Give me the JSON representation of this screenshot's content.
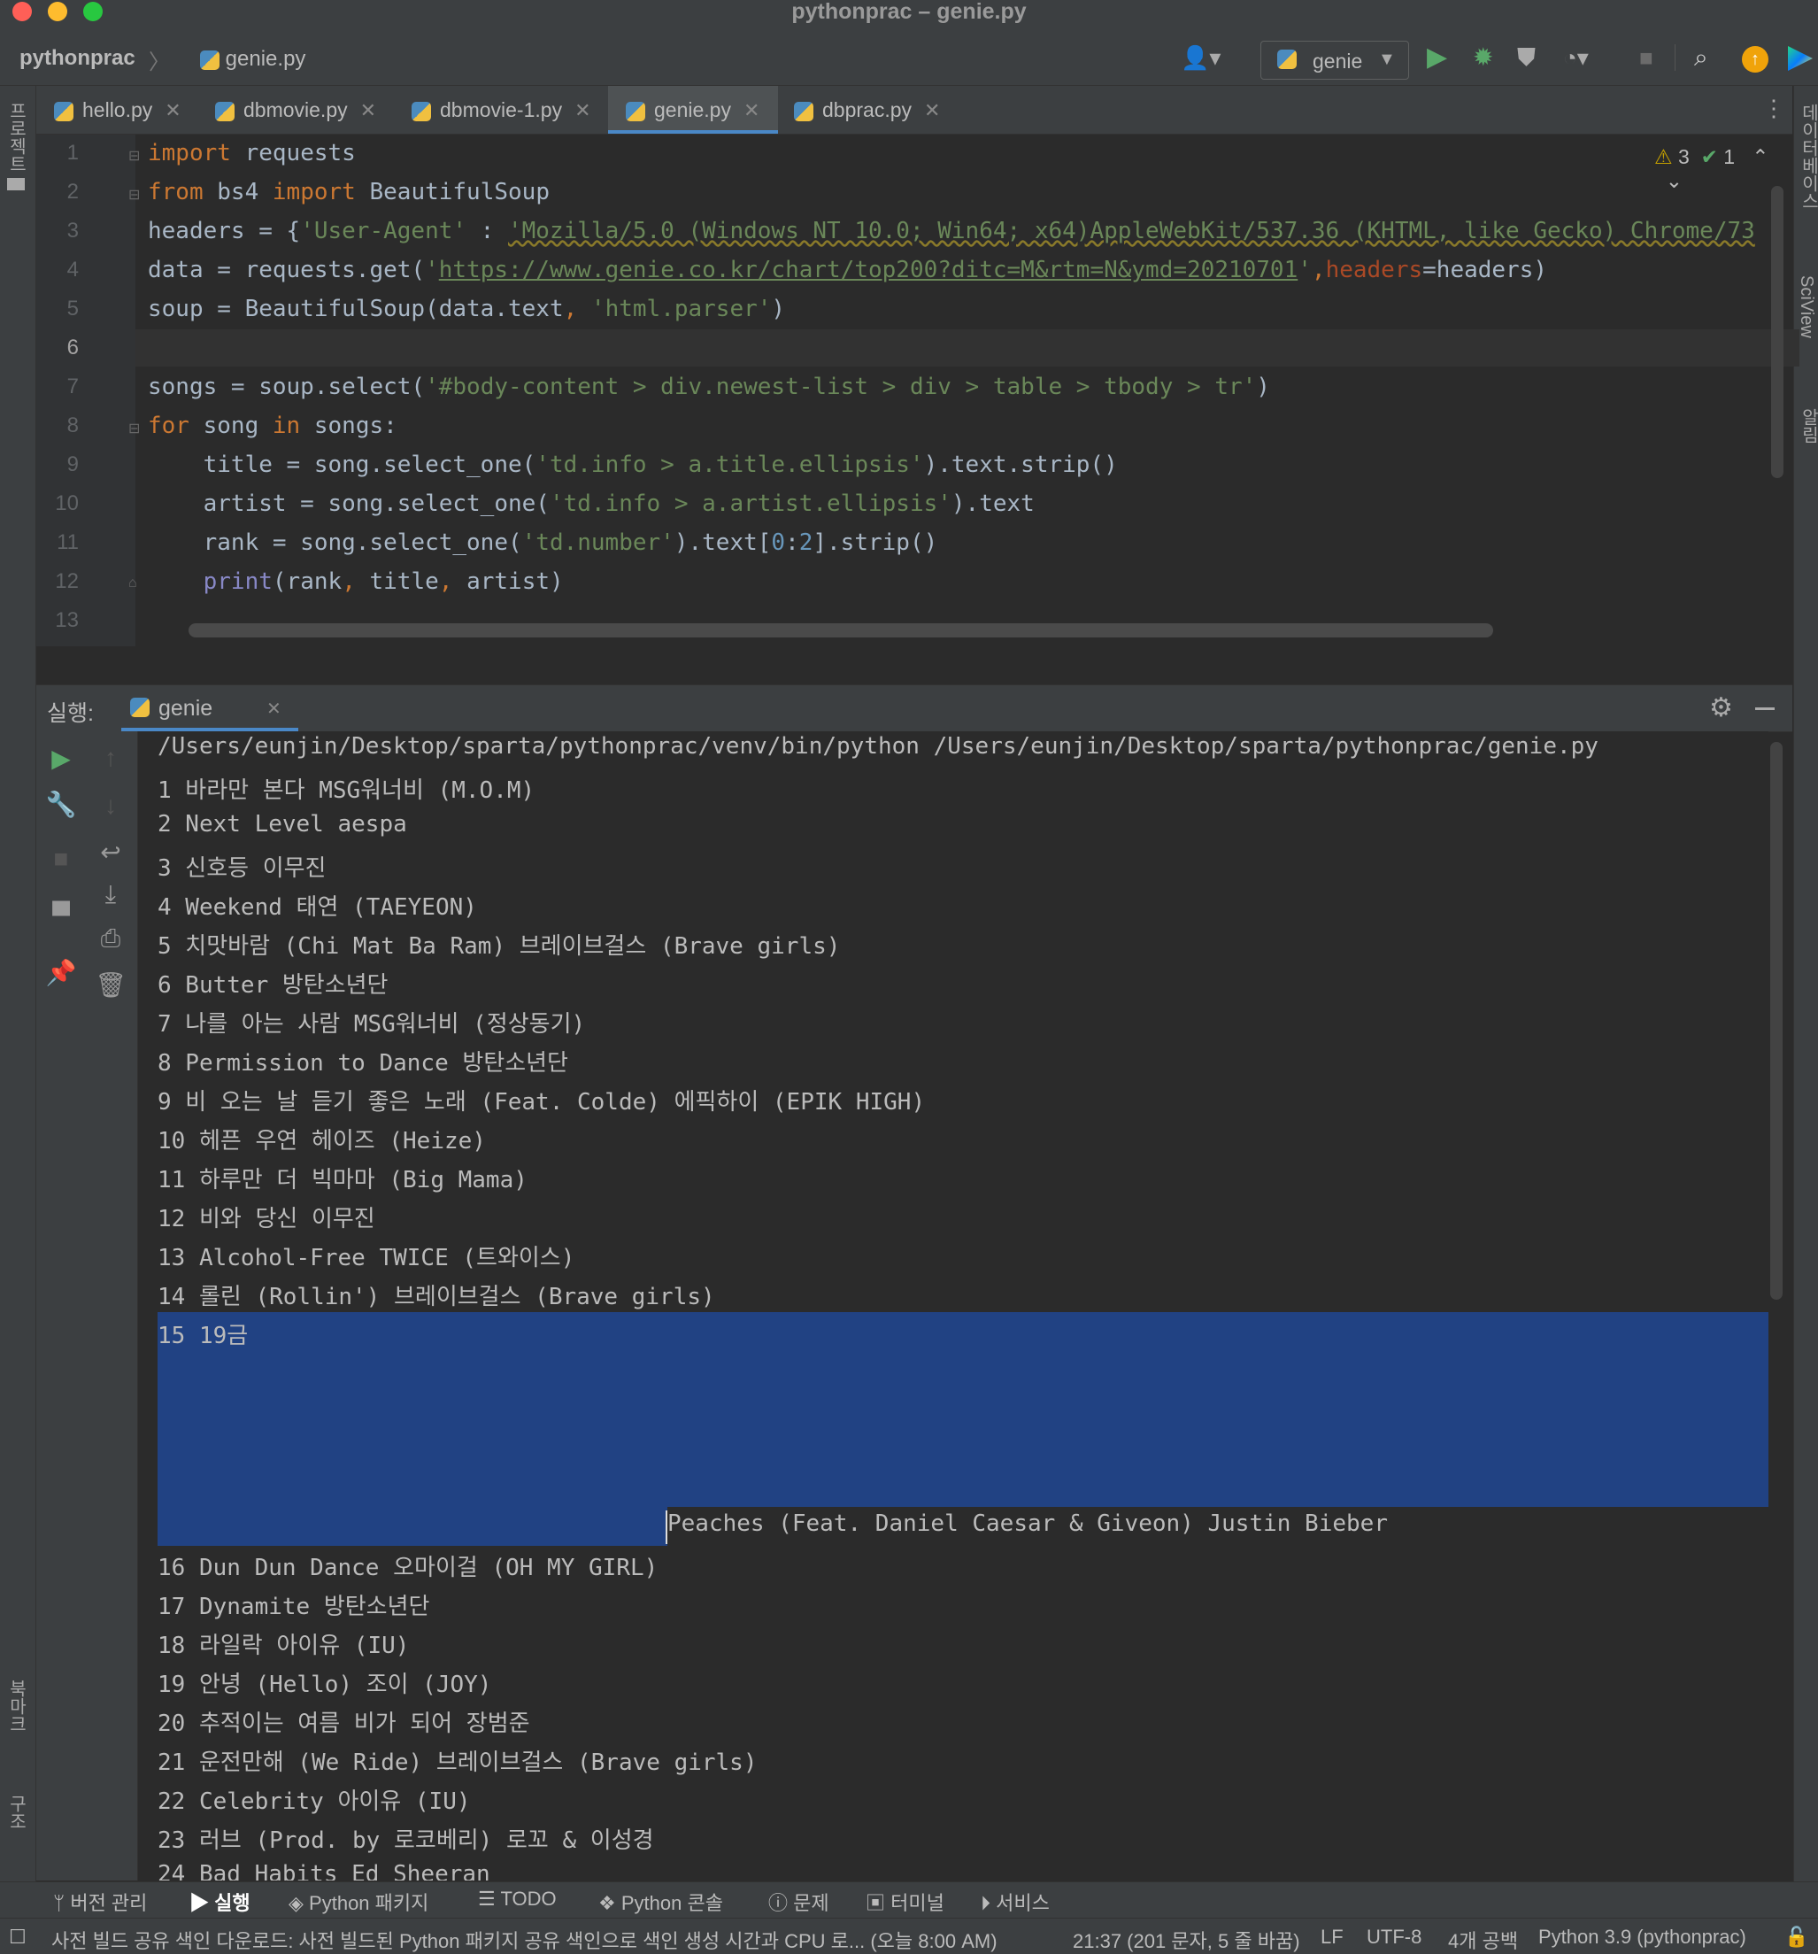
{
  "window": {
    "title": "pythonprac – genie.py",
    "traffic_lights": [
      "#ff5f57",
      "#febc2e",
      "#28c840"
    ]
  },
  "navbar": {
    "project": "pythonprac",
    "separator": "〉",
    "file": "genie.py",
    "run_config": "genie",
    "icons": [
      "user-icon",
      "run-icon",
      "debug-icon",
      "coverage-icon",
      "profile-icon",
      "stop-icon",
      "search-icon",
      "update-icon",
      "plugin-icon"
    ]
  },
  "left_strip": {
    "top_label": "프로젝트",
    "bottom_labels": [
      "북마크",
      "구조"
    ]
  },
  "right_strip": {
    "labels": [
      "데이터베이스",
      "SciView",
      "알림"
    ]
  },
  "tabs": [
    {
      "label": "hello.py",
      "active": false
    },
    {
      "label": "dbmovie.py",
      "active": false
    },
    {
      "label": "dbmovie-1.py",
      "active": false
    },
    {
      "label": "genie.py",
      "active": true
    },
    {
      "label": "dbprac.py",
      "active": false
    }
  ],
  "editor": {
    "inspections": {
      "warnings": "3",
      "ok": "1"
    },
    "line_numbers": [
      "1",
      "2",
      "3",
      "4",
      "5",
      "6",
      "7",
      "8",
      "9",
      "10",
      "11",
      "12",
      "13"
    ],
    "current_line": "6",
    "code": {
      "l1_kw": "import",
      "l1_rest": " requests",
      "l2_kw1": "from",
      "l2_mod": " bs4 ",
      "l2_kw2": "import",
      "l2_rest": " BeautifulSoup",
      "l3_a": "headers = {",
      "l3_key": "'User-Agent'",
      "l3_b": " : ",
      "l3_val": "'Mozilla/5.0 (Windows NT 10.0; Win64; x64)AppleWebKit/537.36 (KHTML, like Gecko) Chrome/73",
      "l4_a": "data = requests.get(",
      "l4_q1": "'",
      "l4_url": "https://www.genie.co.kr/chart/top200?ditc=M&rtm=N&ymd=20210701",
      "l4_q2": "'",
      "l4_comma": ",",
      "l4_param": "headers",
      "l4_b": "=headers)",
      "l5_a": "soup = BeautifulSoup(data.text",
      "l5_comma": ", ",
      "l5_str": "'html.parser'",
      "l5_b": ")",
      "l7_a": "songs = soup.select(",
      "l7_str": "'#body-content > div.newest-list > div > table > tbody > tr'",
      "l7_b": ")",
      "l8_kw1": "for",
      "l8_a": " song ",
      "l8_kw2": "in",
      "l8_b": " songs:",
      "l9_a": "    title = song.select_one(",
      "l9_str": "'td.info > a.title.ellipsis'",
      "l9_b": ").text.strip()",
      "l10_a": "    artist = song.select_one(",
      "l10_str": "'td.info > a.artist.ellipsis'",
      "l10_b": ").text",
      "l11_a": "    rank = song.select_one(",
      "l11_str": "'td.number'",
      "l11_b": ").text[",
      "l11_n1": "0",
      "l11_c": ":",
      "l11_n2": "2",
      "l11_d": "].strip()",
      "l12_indent": "    ",
      "l12_fn": "print",
      "l12_a": "(rank",
      "l12_c1": ", ",
      "l12_b": "title",
      "l12_c2": ", ",
      "l12_d": "artist)"
    }
  },
  "run_panel": {
    "label": "실행:",
    "tab": "genie",
    "command": "/Users/eunjin/Desktop/sparta/pythonprac/venv/bin/python /Users/eunjin/Desktop/sparta/pythonprac/genie.py",
    "output": [
      "1 바라만 본다 MSG워너비 (M.O.M)",
      "2 Next Level aespa",
      "3 신호등 이무진",
      "4 Weekend 태연 (TAEYEON)",
      "5 치맛바람 (Chi Mat Ba Ram) 브레이브걸스 (Brave girls)",
      "6 Butter 방탄소년단",
      "7 나를 아는 사람 MSG워너비 (정상동기)",
      "8 Permission to Dance 방탄소년단",
      "9 비 오는 날 듣기 좋은 노래 (Feat. Colde) 에픽하이 (EPIK HIGH)",
      "10 헤픈 우연 헤이즈 (Heize)",
      "11 하루만 더 빅마마 (Big Mama)",
      "12 비와 당신 이무진",
      "13 Alcohol-Free TWICE (트와이스)",
      "14 롤린 (Rollin') 브레이브걸스 (Brave girls)",
      "15 19금"
    ],
    "output_continued": "Peaches (Feat. Daniel Caesar & Giveon) Justin Bieber",
    "output_after": [
      "16 Dun Dun Dance 오마이걸 (OH MY GIRL)",
      "17 Dynamite 방탄소년단",
      "18 라일락 아이유 (IU)",
      "19 안녕 (Hello) 조이 (JOY)",
      "20 추적이는 여름 비가 되어 장범준",
      "21 운전만해 (We Ride) 브레이브걸스 (Brave girls)",
      "22 Celebrity 아이유 (IU)",
      "23 러브 (Prod. by 로코베리) 로꼬 & 이성경",
      "24 Bad Habits Ed Sheeran"
    ]
  },
  "tool_windows": [
    {
      "label": "버전 관리",
      "icon": "branch-icon",
      "active": false
    },
    {
      "label": "실행",
      "icon": "play-icon",
      "active": true
    },
    {
      "label": "Python 패키지",
      "icon": "layers-icon",
      "active": false
    },
    {
      "label": "TODO",
      "icon": "list-icon",
      "active": false
    },
    {
      "label": "Python 콘솔",
      "icon": "python-icon",
      "active": false
    },
    {
      "label": "문제",
      "icon": "info-icon",
      "active": false
    },
    {
      "label": "터미널",
      "icon": "terminal-icon",
      "active": false
    },
    {
      "label": "서비스",
      "icon": "services-icon",
      "active": false
    }
  ],
  "status_bar": {
    "message": "사전 빌드 공유 색인 다운로드: 사전 빌드된 Python 패키지 공유 색인으로 색인 생성 시간과 CPU 로... (오늘 8:00 AM)",
    "position": "21:37 (201 문자, 5 줄 바꿈)",
    "line_sep": "LF",
    "encoding": "UTF-8",
    "indent": "4개 공백",
    "interpreter": "Python 3.9 (pythonprac)"
  }
}
